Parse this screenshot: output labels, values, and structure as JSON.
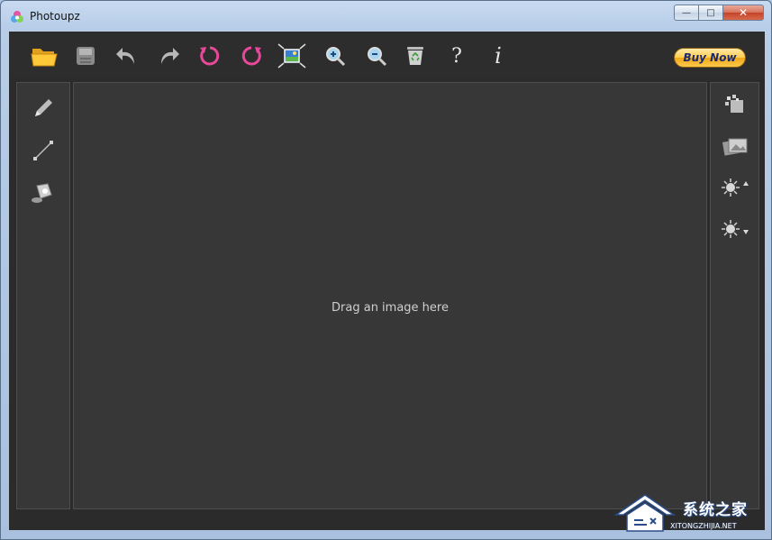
{
  "window": {
    "title": "Photoupz",
    "buttons": {
      "minimize": "—",
      "maximize": "□",
      "close": "✕"
    }
  },
  "toolbar": {
    "items": [
      {
        "name": "open-folder-icon",
        "label": "Open"
      },
      {
        "name": "save-icon",
        "label": "Save"
      },
      {
        "name": "undo-icon",
        "label": "Undo"
      },
      {
        "name": "redo-icon",
        "label": "Redo"
      },
      {
        "name": "rotate-left-icon",
        "label": "Rotate left"
      },
      {
        "name": "rotate-right-icon",
        "label": "Rotate right"
      },
      {
        "name": "fit-image-icon",
        "label": "Fit"
      },
      {
        "name": "zoom-in-icon",
        "label": "Zoom in"
      },
      {
        "name": "zoom-out-icon",
        "label": "Zoom out"
      },
      {
        "name": "recycle-bin-icon",
        "label": "Delete"
      },
      {
        "name": "help-icon",
        "label": "?"
      },
      {
        "name": "info-icon",
        "label": "i"
      }
    ],
    "buy_now": "Buy Now"
  },
  "left_tools": [
    {
      "name": "pencil-icon"
    },
    {
      "name": "line-icon"
    },
    {
      "name": "paint-bucket-icon"
    }
  ],
  "right_tools": [
    {
      "name": "pixelate-icon"
    },
    {
      "name": "photos-icon"
    },
    {
      "name": "brightness-up-icon"
    },
    {
      "name": "brightness-down-icon"
    }
  ],
  "canvas": {
    "hint": "Drag an image here"
  },
  "watermark": {
    "main": "系统之家",
    "sub": "XITONGZHIJIA.NET"
  },
  "colors": {
    "background": "#2b2b2b",
    "panel": "#373737",
    "accent_pink": "#e8489a",
    "buy_now_gold": "#ffc94a"
  }
}
